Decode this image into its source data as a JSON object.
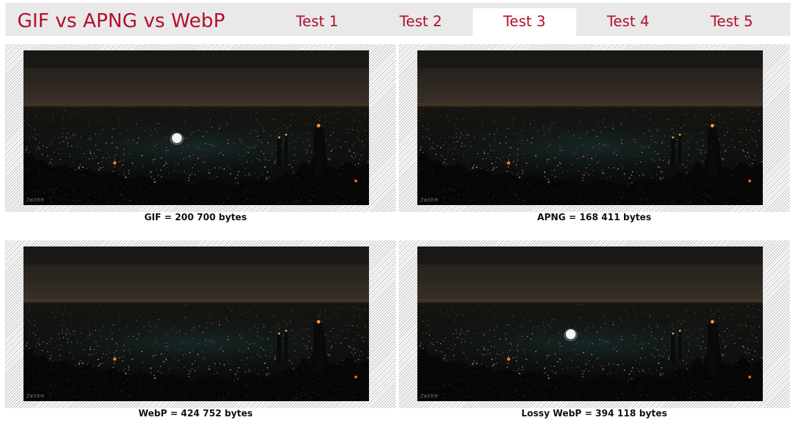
{
  "header": {
    "title": "GIF vs APNG vs WebP",
    "tabs": [
      {
        "label": "Test 1",
        "active": false
      },
      {
        "label": "Test 2",
        "active": false
      },
      {
        "label": "Test 3",
        "active": true
      },
      {
        "label": "Test 4",
        "active": false
      },
      {
        "label": "Test 5",
        "active": false
      }
    ]
  },
  "colors": {
    "accent": "#b3102c",
    "header_bg": "#e9e9e9",
    "active_tab_bg": "#ffffff",
    "caption_text": "#111111"
  },
  "panels": [
    {
      "format": "GIF",
      "caption": "GIF = 200 700 bytes",
      "watermark": "ZWORM"
    },
    {
      "format": "APNG",
      "caption": "APNG = 168 411 bytes",
      "watermark": "ZWORM"
    },
    {
      "format": "WebP",
      "caption": "WebP = 424 752 bytes",
      "watermark": "ZWORM"
    },
    {
      "format": "Lossy WebP",
      "caption": "Lossy WebP = 394 118 bytes",
      "watermark": "ZWORM"
    }
  ]
}
